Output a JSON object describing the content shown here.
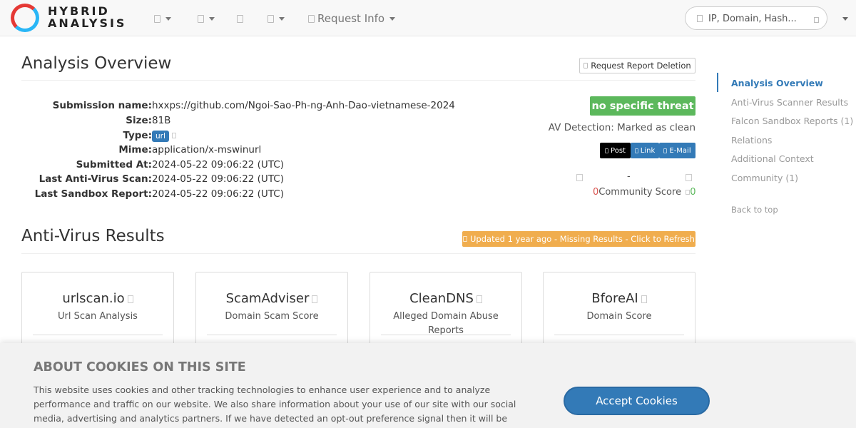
{
  "brand": {
    "line1": "HYBRID",
    "line2": "ANALYSIS"
  },
  "nav": {
    "request_info": "Request Info",
    "search_placeholder": "IP, Domain, Hash..."
  },
  "overview": {
    "title": "Analysis Overview",
    "delete_button": "Request Report Deletion",
    "fields": [
      {
        "key": "Submission name:",
        "value": "hxxps://github.com/Ngoi-Sao-Ph-ng-Anh-Dao-vietnamese-2024"
      },
      {
        "key": "Size:",
        "value": "81B"
      },
      {
        "key": "Type:",
        "value": "url"
      },
      {
        "key": "Mime:",
        "value": "application/x-mswinurl"
      },
      {
        "key": "Submitted At:",
        "value": "2024-05-22 09:06:22 (UTC)"
      },
      {
        "key": "Last Anti-Virus Scan:",
        "value": "2024-05-22 09:06:22 (UTC)"
      },
      {
        "key": "Last Sandbox Report:",
        "value": "2024-05-22 09:06:22 (UTC)"
      }
    ],
    "threat_badge": "no specific threat",
    "av_detection": "AV Detection: Marked as clean",
    "share": {
      "post": "Post",
      "link": "Link",
      "email": "E-Mail"
    },
    "community": {
      "dash": "-",
      "down": "0",
      "label": "Community Score",
      "up": "0"
    }
  },
  "av": {
    "title": "Anti-Virus Results",
    "refresh": "Updated 1 year ago - Missing Results - Click to Refresh",
    "cards": [
      {
        "name": "urlscan.io",
        "desc": "Url Scan Analysis"
      },
      {
        "name": "ScamAdviser",
        "desc": "Domain Scam Score"
      },
      {
        "name": "CleanDNS",
        "desc": "Alleged Domain Abuse Reports"
      },
      {
        "name": "BforeAI",
        "desc": "Domain Score"
      }
    ]
  },
  "sidenav": {
    "items": [
      "Analysis Overview",
      "Anti-Virus Scanner Results",
      "Falcon Sandbox Reports (1)",
      "Relations",
      "Additional Context",
      "Community (1)"
    ],
    "back_to_top": "Back to top"
  },
  "cookie": {
    "title": "ABOUT COOKIES ON THIS SITE",
    "text": "This website uses cookies and other tracking technologies to enhance user experience and to analyze performance and traffic on our website. We also share information about your use of our site with our social media, advertising and analytics partners. If we have detected an opt-out preference signal then it will be honored. Further",
    "accept": "Accept Cookies"
  },
  "colors": {
    "primary": "#337ab7",
    "success": "#5cb85c",
    "warning": "#f0ad4e",
    "danger": "#d9534f"
  }
}
